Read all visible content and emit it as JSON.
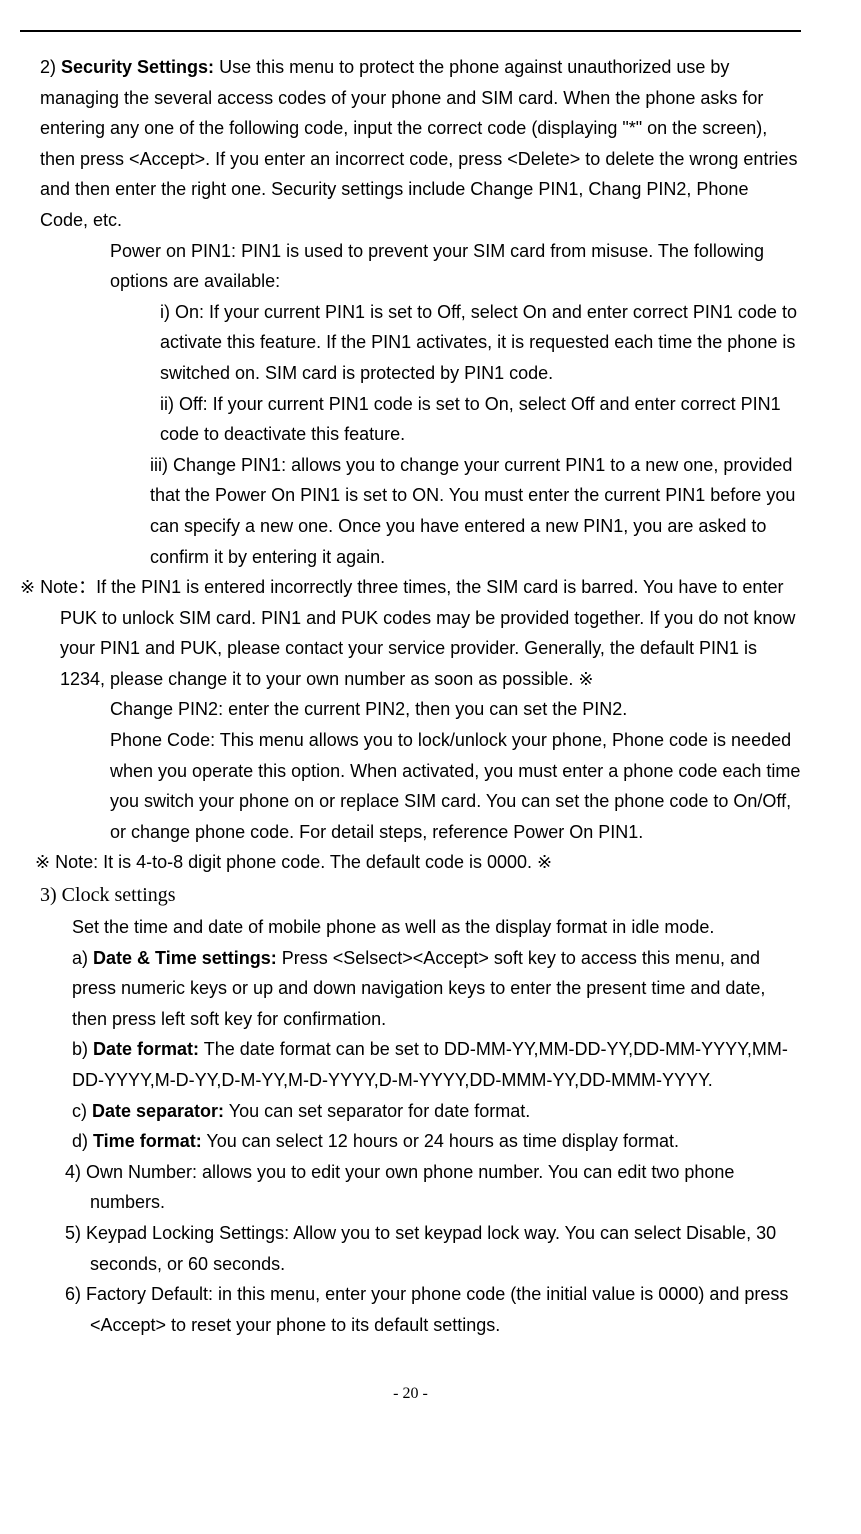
{
  "sections": {
    "item2_label": "2)  ",
    "item2_bold": "Security Settings:",
    "item2_text": " Use this menu to protect the phone against unauthorized use by managing the several access codes of your phone and SIM card. When the phone asks for entering any one of the following code, input the correct code (displaying \"*\" on the screen), then press <Accept>. If you enter an incorrect code, press <Delete> to delete the wrong entries and then enter the right one. Security settings include Change PIN1, Chang PIN2, Phone Code, etc.",
    "poweron_pin1_intro": "Power on PIN1: PIN1 is used to prevent your SIM card from misuse. The following options are available:",
    "sub_i_label": "i)  ",
    "sub_i_text": "On: If your current PIN1 is set to Off, select On and enter correct PIN1 code to activate this feature. If the PIN1 activates, it is requested each time the phone is switched on. SIM card is protected by PIN1 code.",
    "sub_ii_label": "ii)   ",
    "sub_ii_text": "Off: If your current PIN1 code is set to On, select Off and enter correct PIN1 code to deactivate this feature.",
    "sub_iii_label": "iii)  ",
    "sub_iii_text": "Change PIN1: allows you to change your current PIN1 to a new one, provided that the Power On PIN1 is set to ON. You must enter the current PIN1 before you can specify a new one. Once you have entered a new PIN1, you are asked to confirm it by entering it again.",
    "note1": "※ Note：If the PIN1 is entered incorrectly three times, the SIM card is barred. You have to enter PUK to unlock SIM card. PIN1 and PUK codes may be provided together. If you do not know your PIN1 and PUK, please contact your service provider. Generally, the default PIN1 is 1234, please change it to your own number as soon as possible. ※",
    "change_pin2": "Change PIN2: enter the current PIN2, then you can set the PIN2.",
    "phone_code": "Phone Code: This menu allows you to lock/unlock your phone, Phone code is needed when you operate this option. When activated, you must enter a phone code each time you switch your phone on or replace SIM card. You can set the phone code to On/Off, or change phone code. For detail steps, reference Power On PIN1.",
    "note2": "※  Note: It is 4-to-8 digit phone code. The default code is 0000.  ※",
    "item3_label": "3)  ",
    "item3_title": "Clock settings",
    "item3_intro": "Set the time and date of mobile phone as well as the display format in idle mode.",
    "sub_a_label": "a) ",
    "sub_a_bold": "Date & Time settings:",
    "sub_a_text": " Press <Selsect><Accept> soft key to access this menu, and press numeric keys or up and down navigation keys to enter the present time and date, then press left soft key for confirmation.",
    "sub_b_label": "b)  ",
    "sub_b_bold": "Date format:",
    "sub_b_text": " The date format can be set to DD-MM-YY,MM-DD-YY,DD-MM-YYYY,MM-DD-YYYY,M-D-YY,D-M-YY,M-D-YYYY,D-M-YYYY,DD-MMM-YY,DD-MMM-YYYY.",
    "sub_c_label": "c)  ",
    "sub_c_bold": "Date separator:",
    "sub_c_text": " You can set separator for date format.",
    "sub_d_label": "d)  ",
    "sub_d_bold": "Time format:",
    "sub_d_text": " You can select 12 hours or 24 hours as time display format.",
    "item4": "4) Own Number: allows you to edit your own phone number. You can edit two phone numbers.",
    "item5": "5) Keypad Locking Settings: Allow you to set keypad lock way. You can select Disable, 30 seconds, or 60 seconds.",
    "item6": "6) Factory Default: in this menu, enter your phone code (the initial value is 0000) and press <Accept> to reset your phone to its default settings.",
    "page_number": "- 20 -"
  }
}
